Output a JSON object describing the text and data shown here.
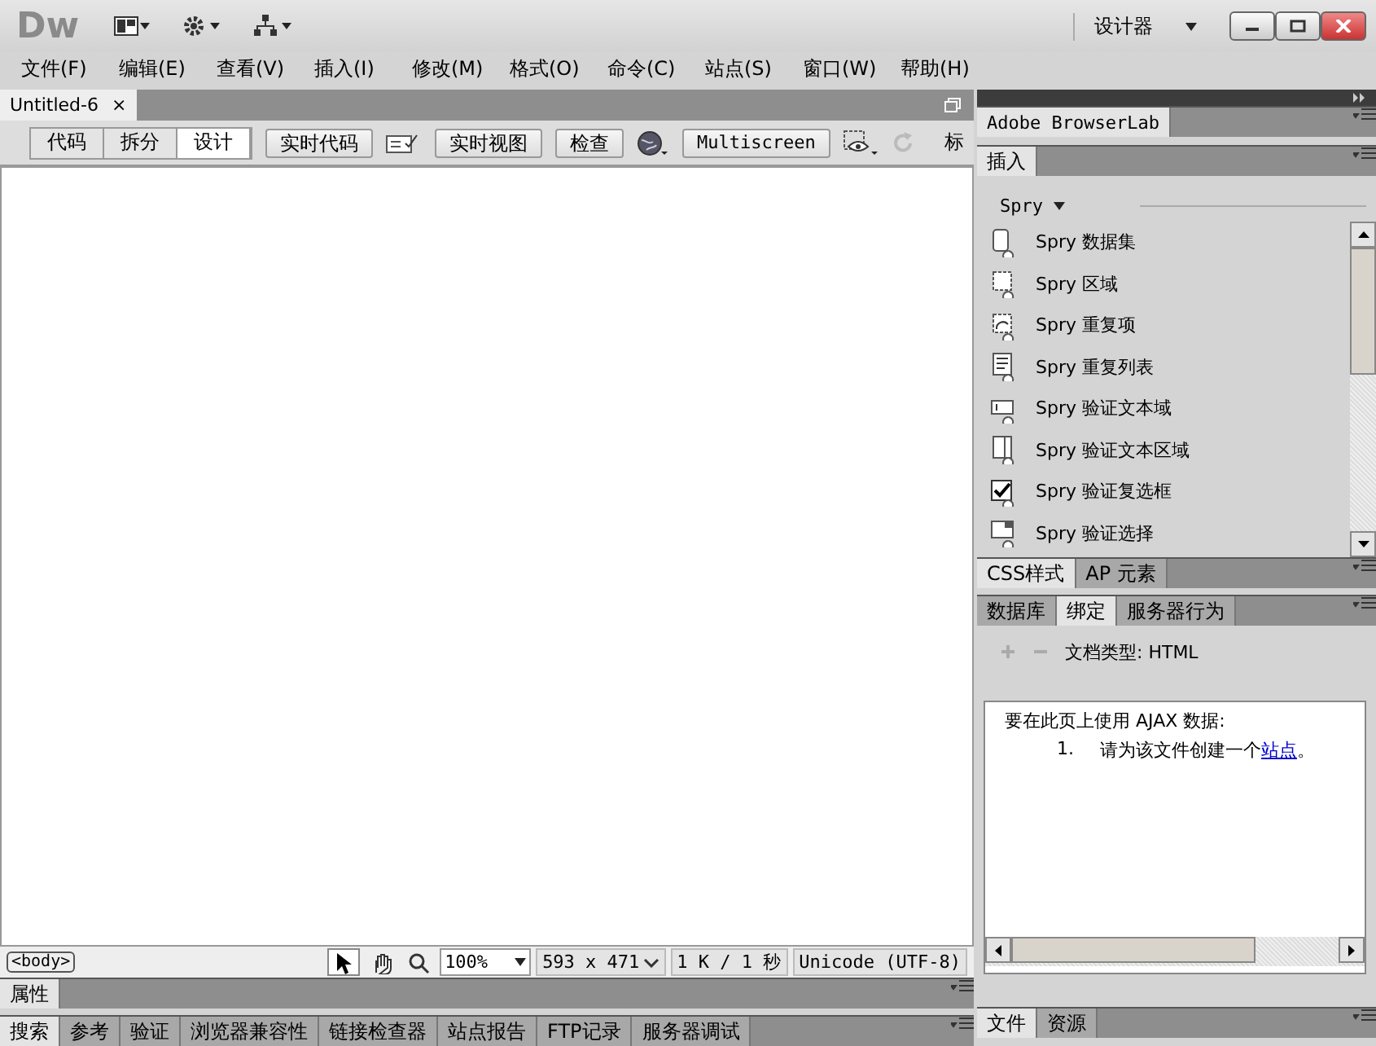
{
  "title_bar": {
    "logo": "Dw",
    "workspace": "设计器"
  },
  "menu": [
    "文件(F)",
    "编辑(E)",
    "查看(V)",
    "插入(I)",
    "修改(M)",
    "格式(O)",
    "命令(C)",
    "站点(S)",
    "窗口(W)",
    "帮助(H)"
  ],
  "document_tab": {
    "label": "Untitled-6",
    "close": "×"
  },
  "toolbar": {
    "views": [
      {
        "label": "代码",
        "selected": false
      },
      {
        "label": "拆分",
        "selected": false
      },
      {
        "label": "设计",
        "selected": true
      }
    ],
    "live_code": "实时代码",
    "live_view": "实时视图",
    "inspect": "检查",
    "multiscreen": "Multiscreen",
    "title_label": "标"
  },
  "status_bar": {
    "tag": "<body>",
    "tools": [
      {
        "kind": "pointer",
        "selected": true
      },
      {
        "kind": "hand",
        "selected": false
      },
      {
        "kind": "zoom",
        "selected": false
      }
    ],
    "zoom": "100%",
    "size": "593 x 471",
    "download": "1 K / 1 秒",
    "encoding": "Unicode (UTF-8)"
  },
  "properties_panel": {
    "title": "属性"
  },
  "results_tabs": [
    {
      "label": "搜索",
      "selected": true
    },
    {
      "label": "参考",
      "selected": false
    },
    {
      "label": "验证",
      "selected": false
    },
    {
      "label": "浏览器兼容性",
      "selected": false
    },
    {
      "label": "链接检查器",
      "selected": false
    },
    {
      "label": "站点报告",
      "selected": false
    },
    {
      "label": "FTP记录",
      "selected": false
    },
    {
      "label": "服务器调试",
      "selected": false
    }
  ],
  "right_panel": {
    "browserlab_tab": "Adobe BrowserLab",
    "insert": {
      "tab": "插入",
      "category": "Spry",
      "items": [
        {
          "kind": "dataset",
          "label": "Spry 数据集"
        },
        {
          "kind": "region",
          "label": "Spry 区域"
        },
        {
          "kind": "repeat",
          "label": "Spry 重复项"
        },
        {
          "kind": "list",
          "label": "Spry 重复列表"
        },
        {
          "kind": "textfield",
          "label": "Spry 验证文本域"
        },
        {
          "kind": "textarea",
          "label": "Spry 验证文本区域"
        },
        {
          "kind": "checkbox",
          "label": "Spry 验证复选框"
        },
        {
          "kind": "select",
          "label": "Spry 验证选择"
        }
      ]
    },
    "css_tabs": [
      {
        "label": "CSS样式",
        "selected": true
      },
      {
        "label": "AP 元素",
        "selected": false
      }
    ],
    "bindings_tabs": [
      {
        "label": "数据库",
        "selected": false
      },
      {
        "label": "绑定",
        "selected": true
      },
      {
        "label": "服务器行为",
        "selected": false
      }
    ],
    "doc_type": "文档类型: HTML",
    "message": "要在此页上使用 AJAX 数据:",
    "step": {
      "number": "1.",
      "text": "请为该文件创建一个",
      "link": "站点",
      "end": "。"
    },
    "files_tabs": [
      {
        "label": "文件",
        "selected": true
      },
      {
        "label": "资源",
        "selected": false
      }
    ]
  }
}
